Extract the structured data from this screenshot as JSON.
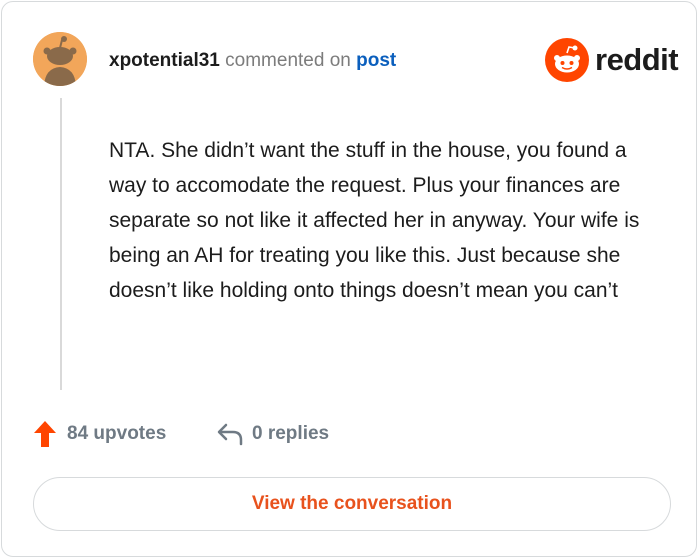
{
  "comment": {
    "username": "xpotential31",
    "action_text": "commented on",
    "link_text": "post",
    "body": "NTA. She didn’t want the stuff in the house, you found a way to accomodate the request. Plus your finances are separate so not like it affected her in anyway. Your wife is being an AH for treating you like this. Just because she doesn’t like holding onto things doesn’t mean you can’t"
  },
  "brand": {
    "name": "reddit",
    "icon": "reddit-logo-icon",
    "color": "#ff4500"
  },
  "stats": {
    "upvotes_label": "84 upvotes",
    "replies_label": "0 replies",
    "upvote_icon": "upvote-arrow-icon",
    "reply_icon": "reply-arrow-icon",
    "upvote_color": "#ff4500"
  },
  "cta": {
    "label": "View the conversation",
    "color": "#e8521d"
  }
}
